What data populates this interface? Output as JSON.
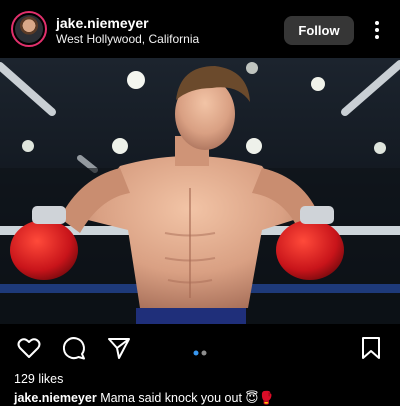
{
  "header": {
    "username": "jake.niemeyer",
    "location": "West Hollywood, California",
    "follow_label": "Follow"
  },
  "photo": {
    "subject": "boxer",
    "carousel_total": 2,
    "carousel_active": 1
  },
  "actions": {
    "icons": [
      "heart-icon",
      "comment-icon",
      "share-icon",
      "bookmark-icon"
    ]
  },
  "likes": "129 likes",
  "caption": {
    "username": "jake.niemeyer",
    "text": "Mama said knock you out",
    "emoji": "😇🥊"
  },
  "colors": {
    "background": "#000000",
    "follow_button": "#363636",
    "carousel_active": "#3897f0",
    "carousel_inactive": "#8e8e8e"
  }
}
